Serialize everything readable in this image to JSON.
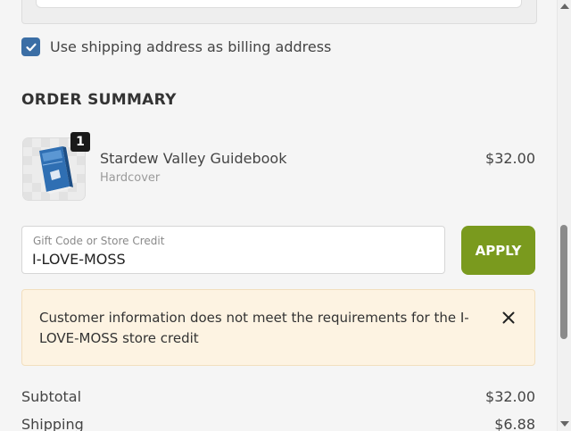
{
  "billing": {
    "use_shipping_checked": true,
    "use_shipping_label": "Use shipping address as billing address"
  },
  "order_summary": {
    "title": "ORDER SUMMARY",
    "items": [
      {
        "quantity": "1",
        "name": "Stardew Valley Guidebook",
        "variant": "Hardcover",
        "price": "$32.00",
        "image_icon": "book-icon"
      }
    ]
  },
  "gift_code": {
    "label": "Gift Code or Store Credit",
    "value": "I-LOVE-MOSS",
    "apply_label": "APPLY"
  },
  "alert": {
    "message": "Customer information does not meet the requirements for the I-LOVE-MOSS store credit",
    "close_icon": "close-icon"
  },
  "totals": {
    "subtotal_label": "Subtotal",
    "subtotal_value": "$32.00",
    "shipping_label": "Shipping",
    "shipping_value": "$6.88"
  },
  "colors": {
    "accent_button": "#7a9a1e",
    "checkbox": "#3b6ea5",
    "alert_bg": "#fdf3e2"
  }
}
